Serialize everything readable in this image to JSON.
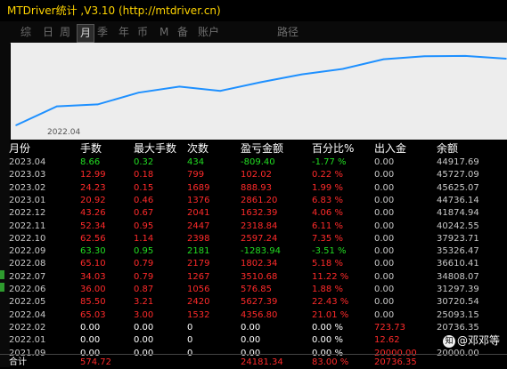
{
  "window": {
    "title": "MTDriver统计 ,V3.10 (http://mtdriver.cn)"
  },
  "tabs": [
    {
      "label": "综",
      "active": false
    },
    {
      "label": "日",
      "active": false
    },
    {
      "label": "周",
      "active": false
    },
    {
      "label": "月",
      "active": true
    },
    {
      "label": "季",
      "active": false
    },
    {
      "label": "年",
      "active": false
    },
    {
      "label": "币",
      "active": false
    },
    {
      "label": "M",
      "active": false
    },
    {
      "label": "备",
      "active": false
    },
    {
      "label": "账户",
      "active": false
    },
    {
      "label": "路径",
      "active": false
    }
  ],
  "chart": {
    "x_label": "2022.04"
  },
  "chart_data": {
    "type": "line",
    "x": [
      "2022.04",
      "2022.05",
      "2022.06",
      "2022.07",
      "2022.08",
      "2022.09",
      "2022.10",
      "2022.11",
      "2022.12",
      "2023.01",
      "2023.02",
      "2023.03",
      "2023.04"
    ],
    "series": [
      {
        "values": [
          25093.15,
          30720.54,
          31297.39,
          34808.07,
          36610.41,
          35326.47,
          37923.71,
          40242.55,
          41874.94,
          44736.14,
          45625.07,
          45727.09,
          44917.69
        ]
      }
    ],
    "ylim": [
      24000,
      46500
    ],
    "color": "#1e90ff"
  },
  "table": {
    "headers": [
      "月份",
      "手数",
      "最大手数",
      "次数",
      "盈亏金额",
      "百分比%",
      "出入金",
      "余额"
    ],
    "rows": [
      {
        "month": "2023.04",
        "lots": "8.66",
        "max_lots": "0.32",
        "count": "434",
        "pnl": "-809.40",
        "pct": "-1.77 %",
        "flow": "0.00",
        "balance": "44917.69",
        "color": "green"
      },
      {
        "month": "2023.03",
        "lots": "12.99",
        "max_lots": "0.18",
        "count": "799",
        "pnl": "102.02",
        "pct": "0.22 %",
        "flow": "0.00",
        "balance": "45727.09",
        "color": "red"
      },
      {
        "month": "2023.02",
        "lots": "24.23",
        "max_lots": "0.15",
        "count": "1689",
        "pnl": "888.93",
        "pct": "1.99 %",
        "flow": "0.00",
        "balance": "45625.07",
        "color": "red"
      },
      {
        "month": "2023.01",
        "lots": "20.92",
        "max_lots": "0.46",
        "count": "1376",
        "pnl": "2861.20",
        "pct": "6.83 %",
        "flow": "0.00",
        "balance": "44736.14",
        "color": "red"
      },
      {
        "month": "2022.12",
        "lots": "43.26",
        "max_lots": "0.67",
        "count": "2041",
        "pnl": "1632.39",
        "pct": "4.06 %",
        "flow": "0.00",
        "balance": "41874.94",
        "color": "red"
      },
      {
        "month": "2022.11",
        "lots": "52.34",
        "max_lots": "0.95",
        "count": "2447",
        "pnl": "2318.84",
        "pct": "6.11 %",
        "flow": "0.00",
        "balance": "40242.55",
        "color": "red"
      },
      {
        "month": "2022.10",
        "lots": "62.56",
        "max_lots": "1.14",
        "count": "2398",
        "pnl": "2597.24",
        "pct": "7.35 %",
        "flow": "0.00",
        "balance": "37923.71",
        "color": "red"
      },
      {
        "month": "2022.09",
        "lots": "63.30",
        "max_lots": "0.95",
        "count": "2181",
        "pnl": "-1283.94",
        "pct": "-3.51 %",
        "flow": "0.00",
        "balance": "35326.47",
        "color": "green"
      },
      {
        "month": "2022.08",
        "lots": "65.10",
        "max_lots": "0.79",
        "count": "2179",
        "pnl": "1802.34",
        "pct": "5.18 %",
        "flow": "0.00",
        "balance": "36610.41",
        "color": "red"
      },
      {
        "month": "2022.07",
        "lots": "34.03",
        "max_lots": "0.79",
        "count": "1267",
        "pnl": "3510.68",
        "pct": "11.22 %",
        "flow": "0.00",
        "balance": "34808.07",
        "color": "red"
      },
      {
        "month": "2022.06",
        "lots": "36.00",
        "max_lots": "0.87",
        "count": "1056",
        "pnl": "576.85",
        "pct": "1.88 %",
        "flow": "0.00",
        "balance": "31297.39",
        "color": "red"
      },
      {
        "month": "2022.05",
        "lots": "85.50",
        "max_lots": "3.21",
        "count": "2420",
        "pnl": "5627.39",
        "pct": "22.43 %",
        "flow": "0.00",
        "balance": "30720.54",
        "color": "red"
      },
      {
        "month": "2022.04",
        "lots": "65.03",
        "max_lots": "3.00",
        "count": "1532",
        "pnl": "4356.80",
        "pct": "21.01 %",
        "flow": "0.00",
        "balance": "25093.15",
        "color": "red"
      },
      {
        "month": "2022.02",
        "lots": "0.00",
        "max_lots": "0.00",
        "count": "0",
        "pnl": "0.00",
        "pct": "0.00 %",
        "flow": "723.73",
        "balance": "20736.35",
        "color": "white",
        "flow_color": "red"
      },
      {
        "month": "2022.01",
        "lots": "0.00",
        "max_lots": "0.00",
        "count": "0",
        "pnl": "0.00",
        "pct": "0.00 %",
        "flow": "12.62",
        "balance": "",
        "color": "white",
        "flow_color": "red"
      },
      {
        "month": "2021.09",
        "lots": "0.00",
        "max_lots": "0.00",
        "count": "0",
        "pnl": "0.00",
        "pct": "0.00 %",
        "flow": "20000.00",
        "balance": "20000.00",
        "color": "white",
        "flow_color": "red"
      }
    ],
    "total": {
      "label": "合计",
      "lots": "574.72",
      "pnl": "24181.34",
      "pct": "83.00 %",
      "balance": "20736.35"
    }
  },
  "watermark": {
    "logo": "知",
    "text": "@邓邓等"
  },
  "colors": {
    "green": "#22dd22",
    "red": "#ff2a2a",
    "white": "#ffffff",
    "line": "#1e90ff"
  }
}
